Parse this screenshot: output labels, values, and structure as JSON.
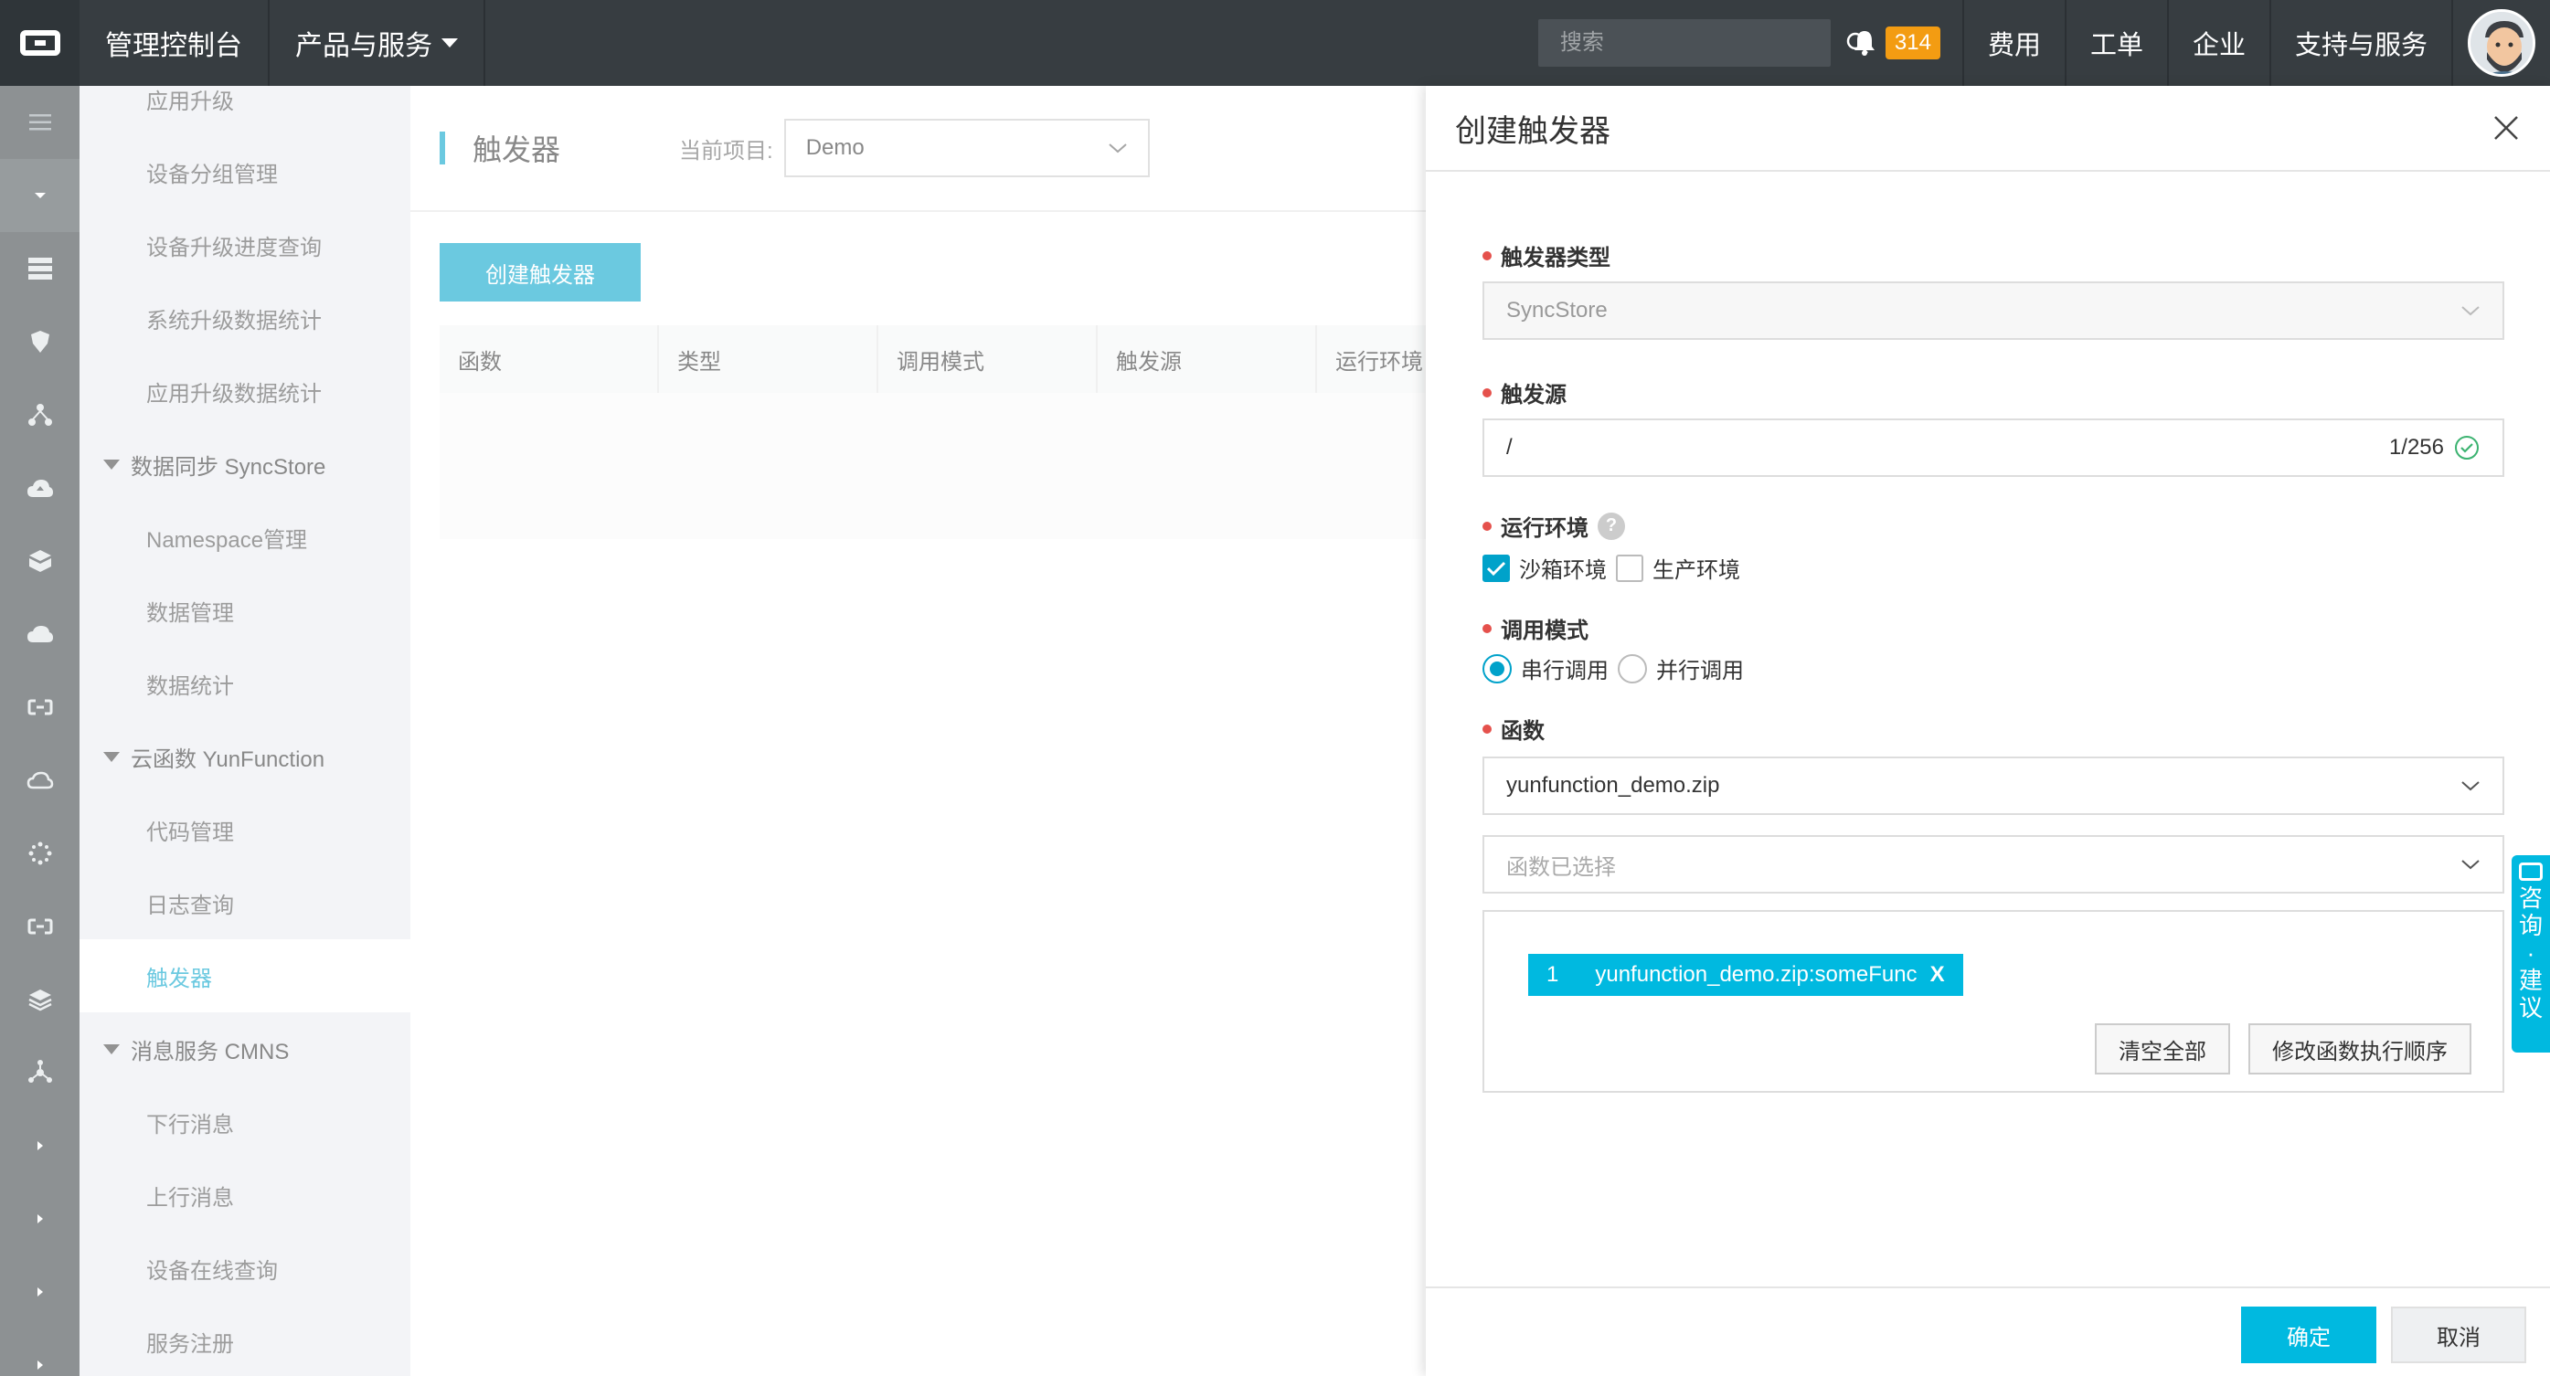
{
  "topbar": {
    "console": "管理控制台",
    "products": "产品与服务",
    "search_placeholder": "搜索",
    "badge_count": "314",
    "links": [
      "费用",
      "工单",
      "企业",
      "支持与服务"
    ]
  },
  "sidebar": {
    "items": [
      {
        "label": "应用升级",
        "type": "item"
      },
      {
        "label": "设备分组管理",
        "type": "item"
      },
      {
        "label": "设备升级进度查询",
        "type": "item"
      },
      {
        "label": "系统升级数据统计",
        "type": "item"
      },
      {
        "label": "应用升级数据统计",
        "type": "item"
      },
      {
        "label": "数据同步 SyncStore",
        "type": "group"
      },
      {
        "label": "Namespace管理",
        "type": "item"
      },
      {
        "label": "数据管理",
        "type": "item"
      },
      {
        "label": "数据统计",
        "type": "item"
      },
      {
        "label": "云函数 YunFunction",
        "type": "group"
      },
      {
        "label": "代码管理",
        "type": "item"
      },
      {
        "label": "日志查询",
        "type": "item"
      },
      {
        "label": "触发器",
        "type": "item",
        "active": true
      },
      {
        "label": "消息服务 CMNS",
        "type": "group"
      },
      {
        "label": "下行消息",
        "type": "item"
      },
      {
        "label": "上行消息",
        "type": "item"
      },
      {
        "label": "设备在线查询",
        "type": "item"
      },
      {
        "label": "服务注册",
        "type": "item"
      }
    ]
  },
  "main": {
    "title": "触发器",
    "project_label": "当前项目:",
    "project_value": "Demo",
    "create_button": "创建触发器",
    "columns": [
      "函数",
      "类型",
      "调用模式",
      "触发源",
      "运行环境"
    ]
  },
  "drawer": {
    "title": "创建触发器",
    "trigger_type_label": "触发器类型",
    "trigger_type_value": "SyncStore",
    "source_label": "触发源",
    "source_value": "/",
    "source_count": "1/256",
    "env_label": "运行环境",
    "env_help": "?",
    "env_sandbox": "沙箱环境",
    "env_prod": "生产环境",
    "mode_label": "调用模式",
    "mode_serial": "串行调用",
    "mode_parallel": "并行调用",
    "function_label": "函数",
    "function_value": "yunfunction_demo.zip",
    "function_selected_placeholder": "函数已选择",
    "chip_index": "1",
    "chip_label": "yunfunction_demo.zip:someFunc",
    "chip_remove": "X",
    "clear_all": "清空全部",
    "reorder": "修改函数执行顺序",
    "confirm": "确定",
    "cancel": "取消"
  },
  "consult": {
    "chars": [
      "咨",
      "询",
      "·",
      "建",
      "议"
    ]
  },
  "colors": {
    "accent": "#00a2ca",
    "topbar": "#373d41",
    "badge": "#f39c12",
    "required": "#e5514c"
  }
}
